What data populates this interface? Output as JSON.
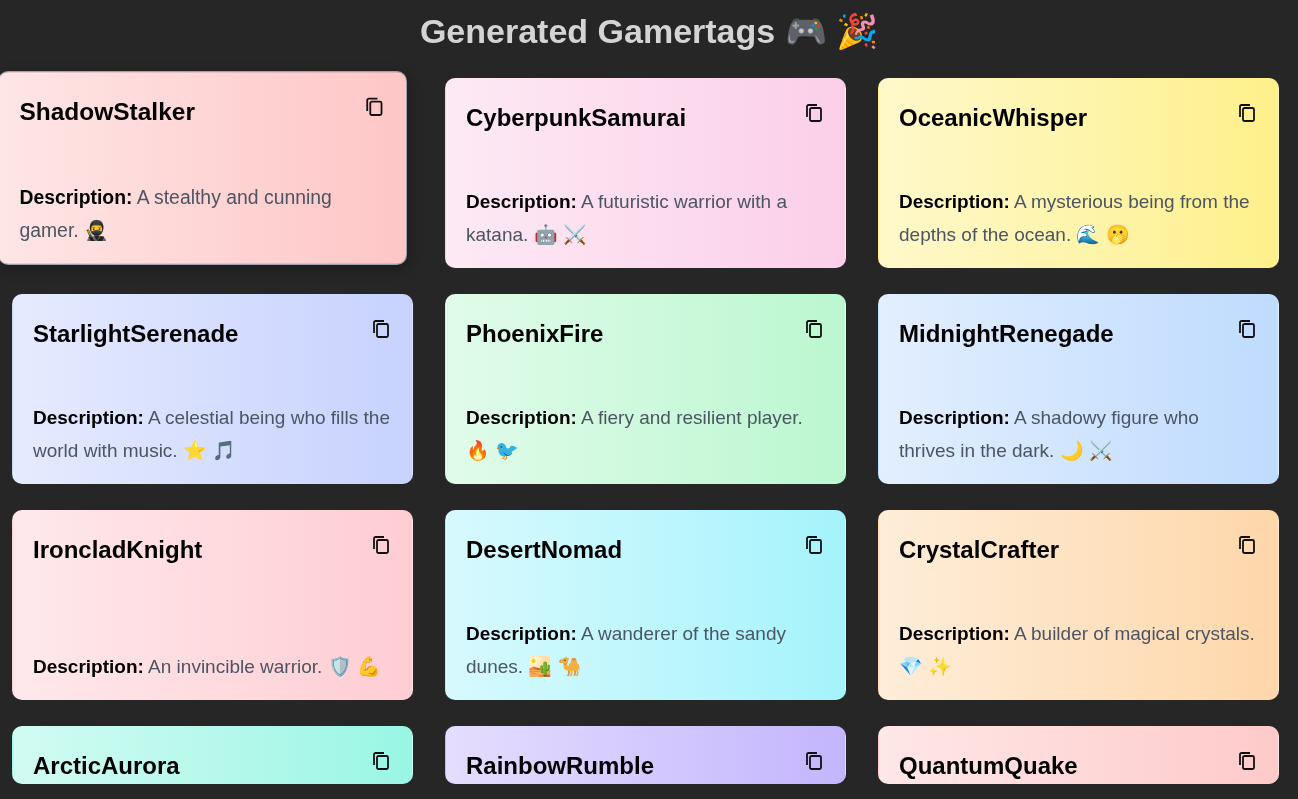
{
  "page": {
    "title": "Generated Gamertags 🎮 🎉"
  },
  "cards": [
    {
      "name": "ShadowStalker",
      "description": "**Description:** A stealthy and cunning gamer. 🥷",
      "hovered": true,
      "color": "#fec6c6"
    },
    {
      "name": "CyberpunkSamurai",
      "description": "**Description:** A futuristic warrior with a katana. 🤖 ⚔️",
      "hovered": false,
      "color": "#fbcfe8"
    },
    {
      "name": "OceanicWhisper",
      "description": "**Description:** A mysterious being from the depths of the ocean. 🌊 🫢",
      "hovered": false,
      "color": "#fef08a"
    },
    {
      "name": "StarlightSerenade",
      "description": "**Description:** A celestial being who fills the world with music. ⭐ 🎵",
      "hovered": false,
      "color": "#c7d2fe"
    },
    {
      "name": "PhoenixFire",
      "description": "**Description:** A fiery and resilient player. 🔥 🐦",
      "hovered": false,
      "color": "#bbf7d0"
    },
    {
      "name": "MidnightRenegade",
      "description": "**Description:** A shadowy figure who thrives in the dark. 🌙 ⚔️",
      "hovered": false,
      "color": "#bfdbfe"
    },
    {
      "name": "IroncladKnight",
      "description": "**Description:** An invincible warrior. 🛡️ 💪",
      "hovered": false,
      "color": "#fecdd3"
    },
    {
      "name": "DesertNomad",
      "description": "**Description:** A wanderer of the sandy dunes. 🏜️ 🐪",
      "hovered": false,
      "color": "#a5f3fc"
    },
    {
      "name": "CrystalCrafter",
      "description": "**Description:** A builder of magical crystals. 💎 ✨",
      "hovered": false,
      "color": "#fed7aa"
    },
    {
      "name": "ArcticAurora",
      "hovered": false,
      "color": "#99f6e4"
    },
    {
      "name": "RainbowRumble",
      "hovered": false,
      "color": "#c4b5fd"
    },
    {
      "name": "QuantumQuake",
      "hovered": false,
      "color": "#fecaca"
    }
  ]
}
